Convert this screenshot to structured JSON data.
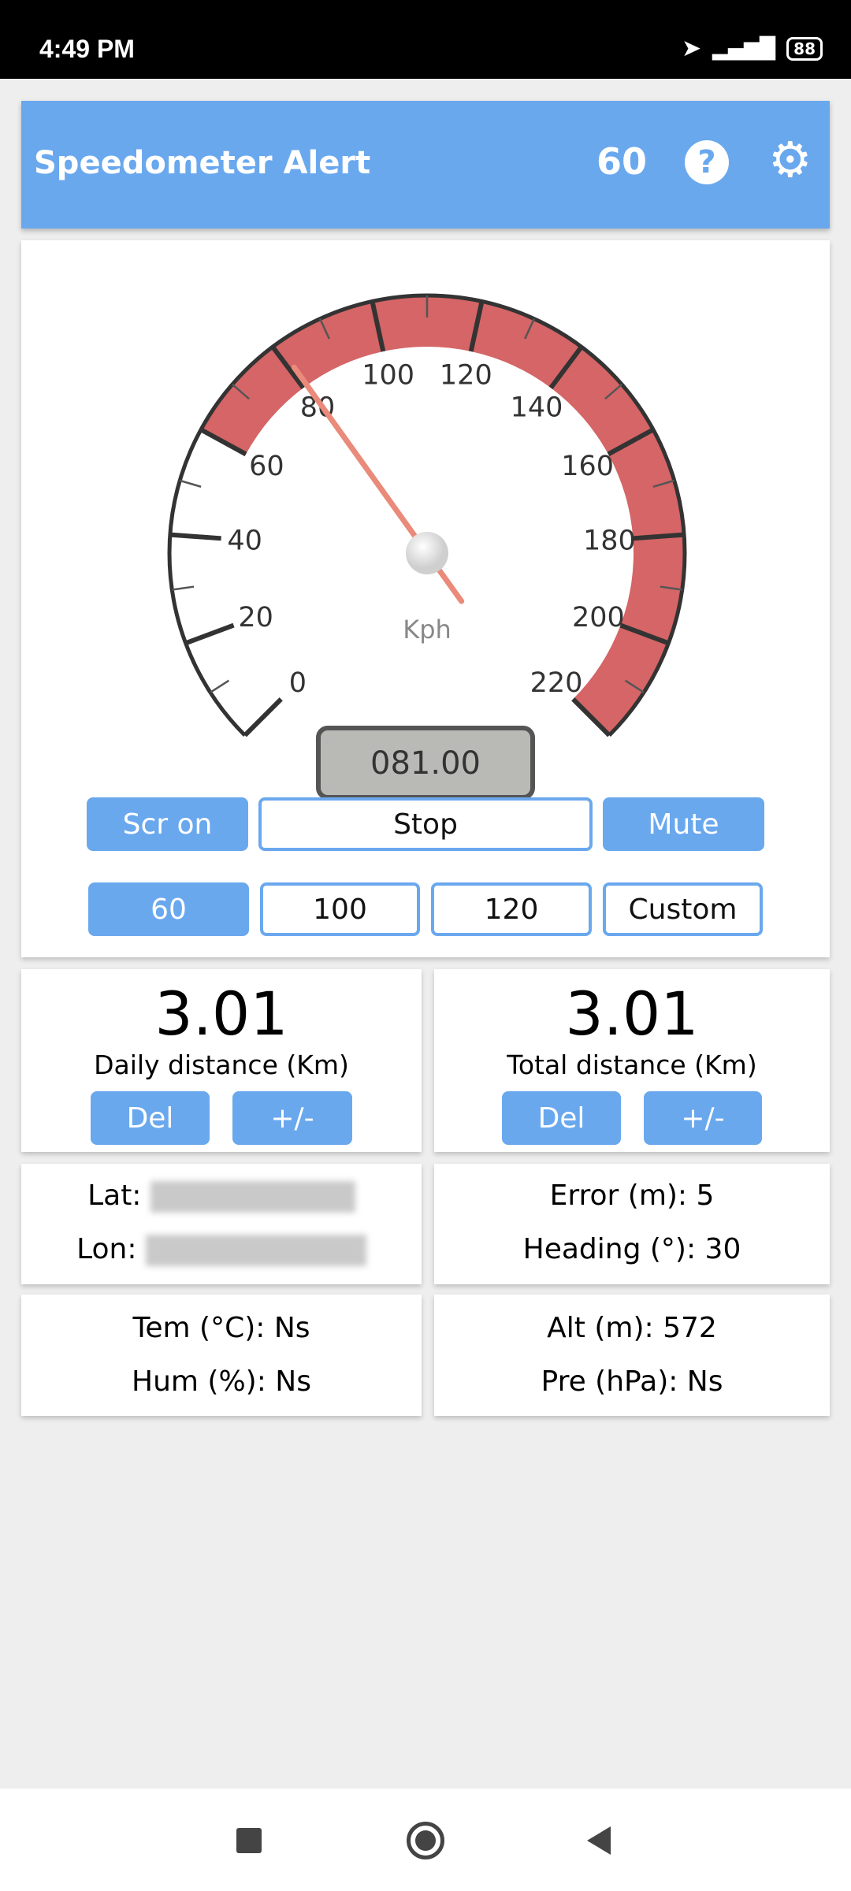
{
  "status_bar": {
    "time": "4:49 PM",
    "battery": "88",
    "icons": [
      "location-arrow-icon",
      "signal-icon",
      "battery-icon"
    ]
  },
  "app_bar": {
    "title": "Speedometer Alert",
    "speed_limit": "60",
    "help_icon": "help-circle-icon",
    "settings_icon": "gear-icon",
    "color": "#6aa8ee"
  },
  "gauge": {
    "min": 0,
    "max": 220,
    "value": 81,
    "warning_start": 60,
    "unit": "Kph",
    "readout": "081.00",
    "major_labels": [
      "0",
      "20",
      "40",
      "60",
      "80",
      "100",
      "120",
      "140",
      "160",
      "180",
      "200",
      "220"
    ],
    "band_color": "#d56566"
  },
  "controls": {
    "screen_on": "Scr on",
    "stop": "Stop",
    "mute": "Mute",
    "presets": [
      "60",
      "100",
      "120",
      "Custom"
    ],
    "selected_preset": "60"
  },
  "daily": {
    "value": "3.01",
    "label": "Daily distance (Km)",
    "del": "Del",
    "adjust": "+/-"
  },
  "total": {
    "value": "3.01",
    "label": "Total distance (Km)",
    "del": "Del",
    "adjust": "+/-"
  },
  "location": {
    "lat_label": "Lat:",
    "lon_label": "Lon:"
  },
  "accuracy": {
    "error": "Error (m): 5",
    "heading": "Heading (°): 30"
  },
  "weather": {
    "temp": "Tem (°C): Ns",
    "hum": "Hum (%): Ns"
  },
  "altitude": {
    "alt": "Alt (m): 572",
    "pressure": "Pre (hPa): Ns"
  }
}
